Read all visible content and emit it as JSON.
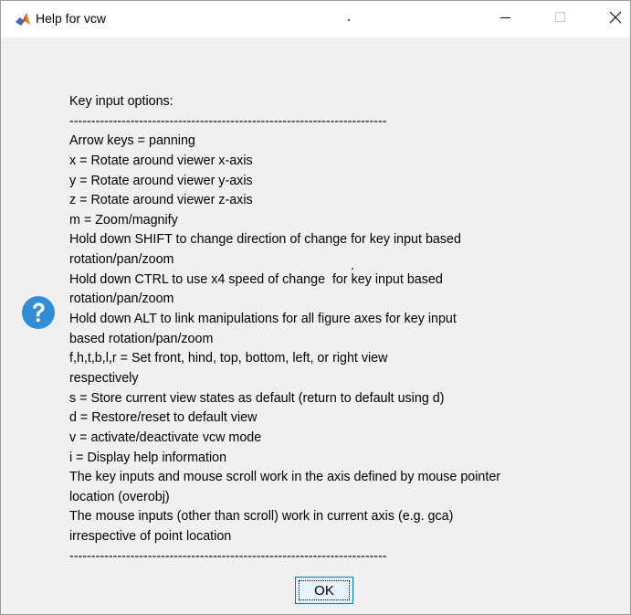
{
  "window": {
    "title": "Help for vcw",
    "app_icon": "matlab-icon",
    "controls": {
      "minimize_icon": "minimize-icon",
      "maximize_icon": "maximize-icon",
      "close_icon": "close-icon"
    }
  },
  "dialog": {
    "icon": "question-icon",
    "icon_color": "#2f8ed6",
    "message_lines": [
      "Key input options:",
      "-------------------------------------------------------------------------",
      "Arrow keys = panning",
      "x = Rotate around viewer x-axis",
      "y = Rotate around viewer y-axis",
      "z = Rotate around viewer z-axis",
      "m = Zoom/magnify",
      "Hold down SHIFT to change direction of change for key input based",
      "rotation/pan/zoom",
      "Hold down CTRL to use x4 speed of change  for key input based",
      "rotation/pan/zoom",
      "Hold down ALT to link manipulations for all figure axes for key input",
      "based rotation/pan/zoom",
      "f,h,t,b,l,r = Set front, hind, top, bottom, left, or right view",
      "respectively",
      "s = Store current view states as default (return to default using d)",
      "d = Restore/reset to default view",
      "v = activate/deactivate vcw mode",
      "i = Display help information",
      "The key inputs and mouse scroll work in the axis defined by mouse pointer",
      "location (overobj)",
      "The mouse inputs (other than scroll) work in current axis (e.g. gca)",
      "irrespective of point location",
      "-------------------------------------------------------------------------"
    ],
    "ok_label": "OK",
    "ok_focus_color": "#0078d7"
  }
}
